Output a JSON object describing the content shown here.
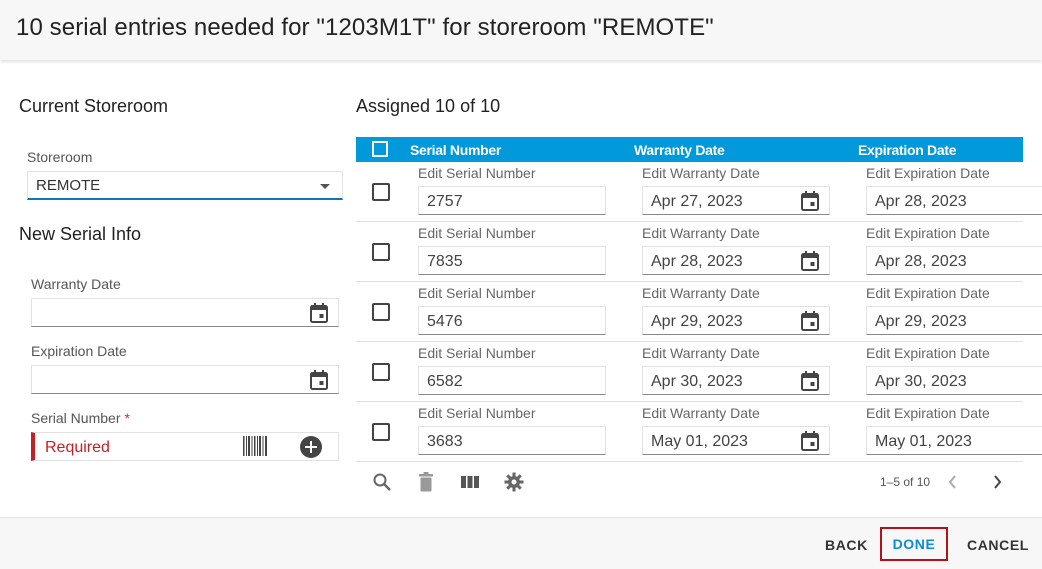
{
  "dialog": {
    "title": "10 serial entries needed for \"1203M1T\" for storeroom \"REMOTE\""
  },
  "left": {
    "current_storeroom_title": "Current Storeroom",
    "storeroom_label": "Storeroom",
    "storeroom_value": "REMOTE",
    "new_serial_title": "New Serial Info",
    "warranty_label": "Warranty Date",
    "warranty_value": "",
    "expiration_label": "Expiration Date",
    "expiration_value": "",
    "serial_label": "Serial Number",
    "serial_required_mark": "*",
    "serial_placeholder": "Required"
  },
  "grid": {
    "assigned_title": "Assigned 10 of 10",
    "columns": [
      "Serial Number",
      "Warranty Date",
      "Expiration Date"
    ],
    "edit_labels": [
      "Edit Serial Number",
      "Edit Warranty Date",
      "Edit Expiration Date"
    ],
    "rows": [
      {
        "serial": "2757",
        "warranty": "Apr 27, 2023",
        "expiration": "Apr 28, 2023"
      },
      {
        "serial": "7835",
        "warranty": "Apr 28, 2023",
        "expiration": "Apr 28, 2023"
      },
      {
        "serial": "5476",
        "warranty": "Apr 29, 2023",
        "expiration": "Apr 29, 2023"
      },
      {
        "serial": "6582",
        "warranty": "Apr 30, 2023",
        "expiration": "Apr 30, 2023"
      },
      {
        "serial": "3683",
        "warranty": "May 01, 2023",
        "expiration": "May 01, 2023"
      }
    ],
    "pager": "1–5 of 10",
    "toolbar_icons": [
      "search-icon",
      "trash-icon",
      "columns-icon",
      "gear-icon"
    ]
  },
  "footer": {
    "back_label": "BACK",
    "done_label": "DONE",
    "cancel_label": "CANCEL"
  },
  "colors": {
    "header_blue": "#0199d9",
    "required_red": "#c42127",
    "done_blue": "#0f8bd3"
  }
}
